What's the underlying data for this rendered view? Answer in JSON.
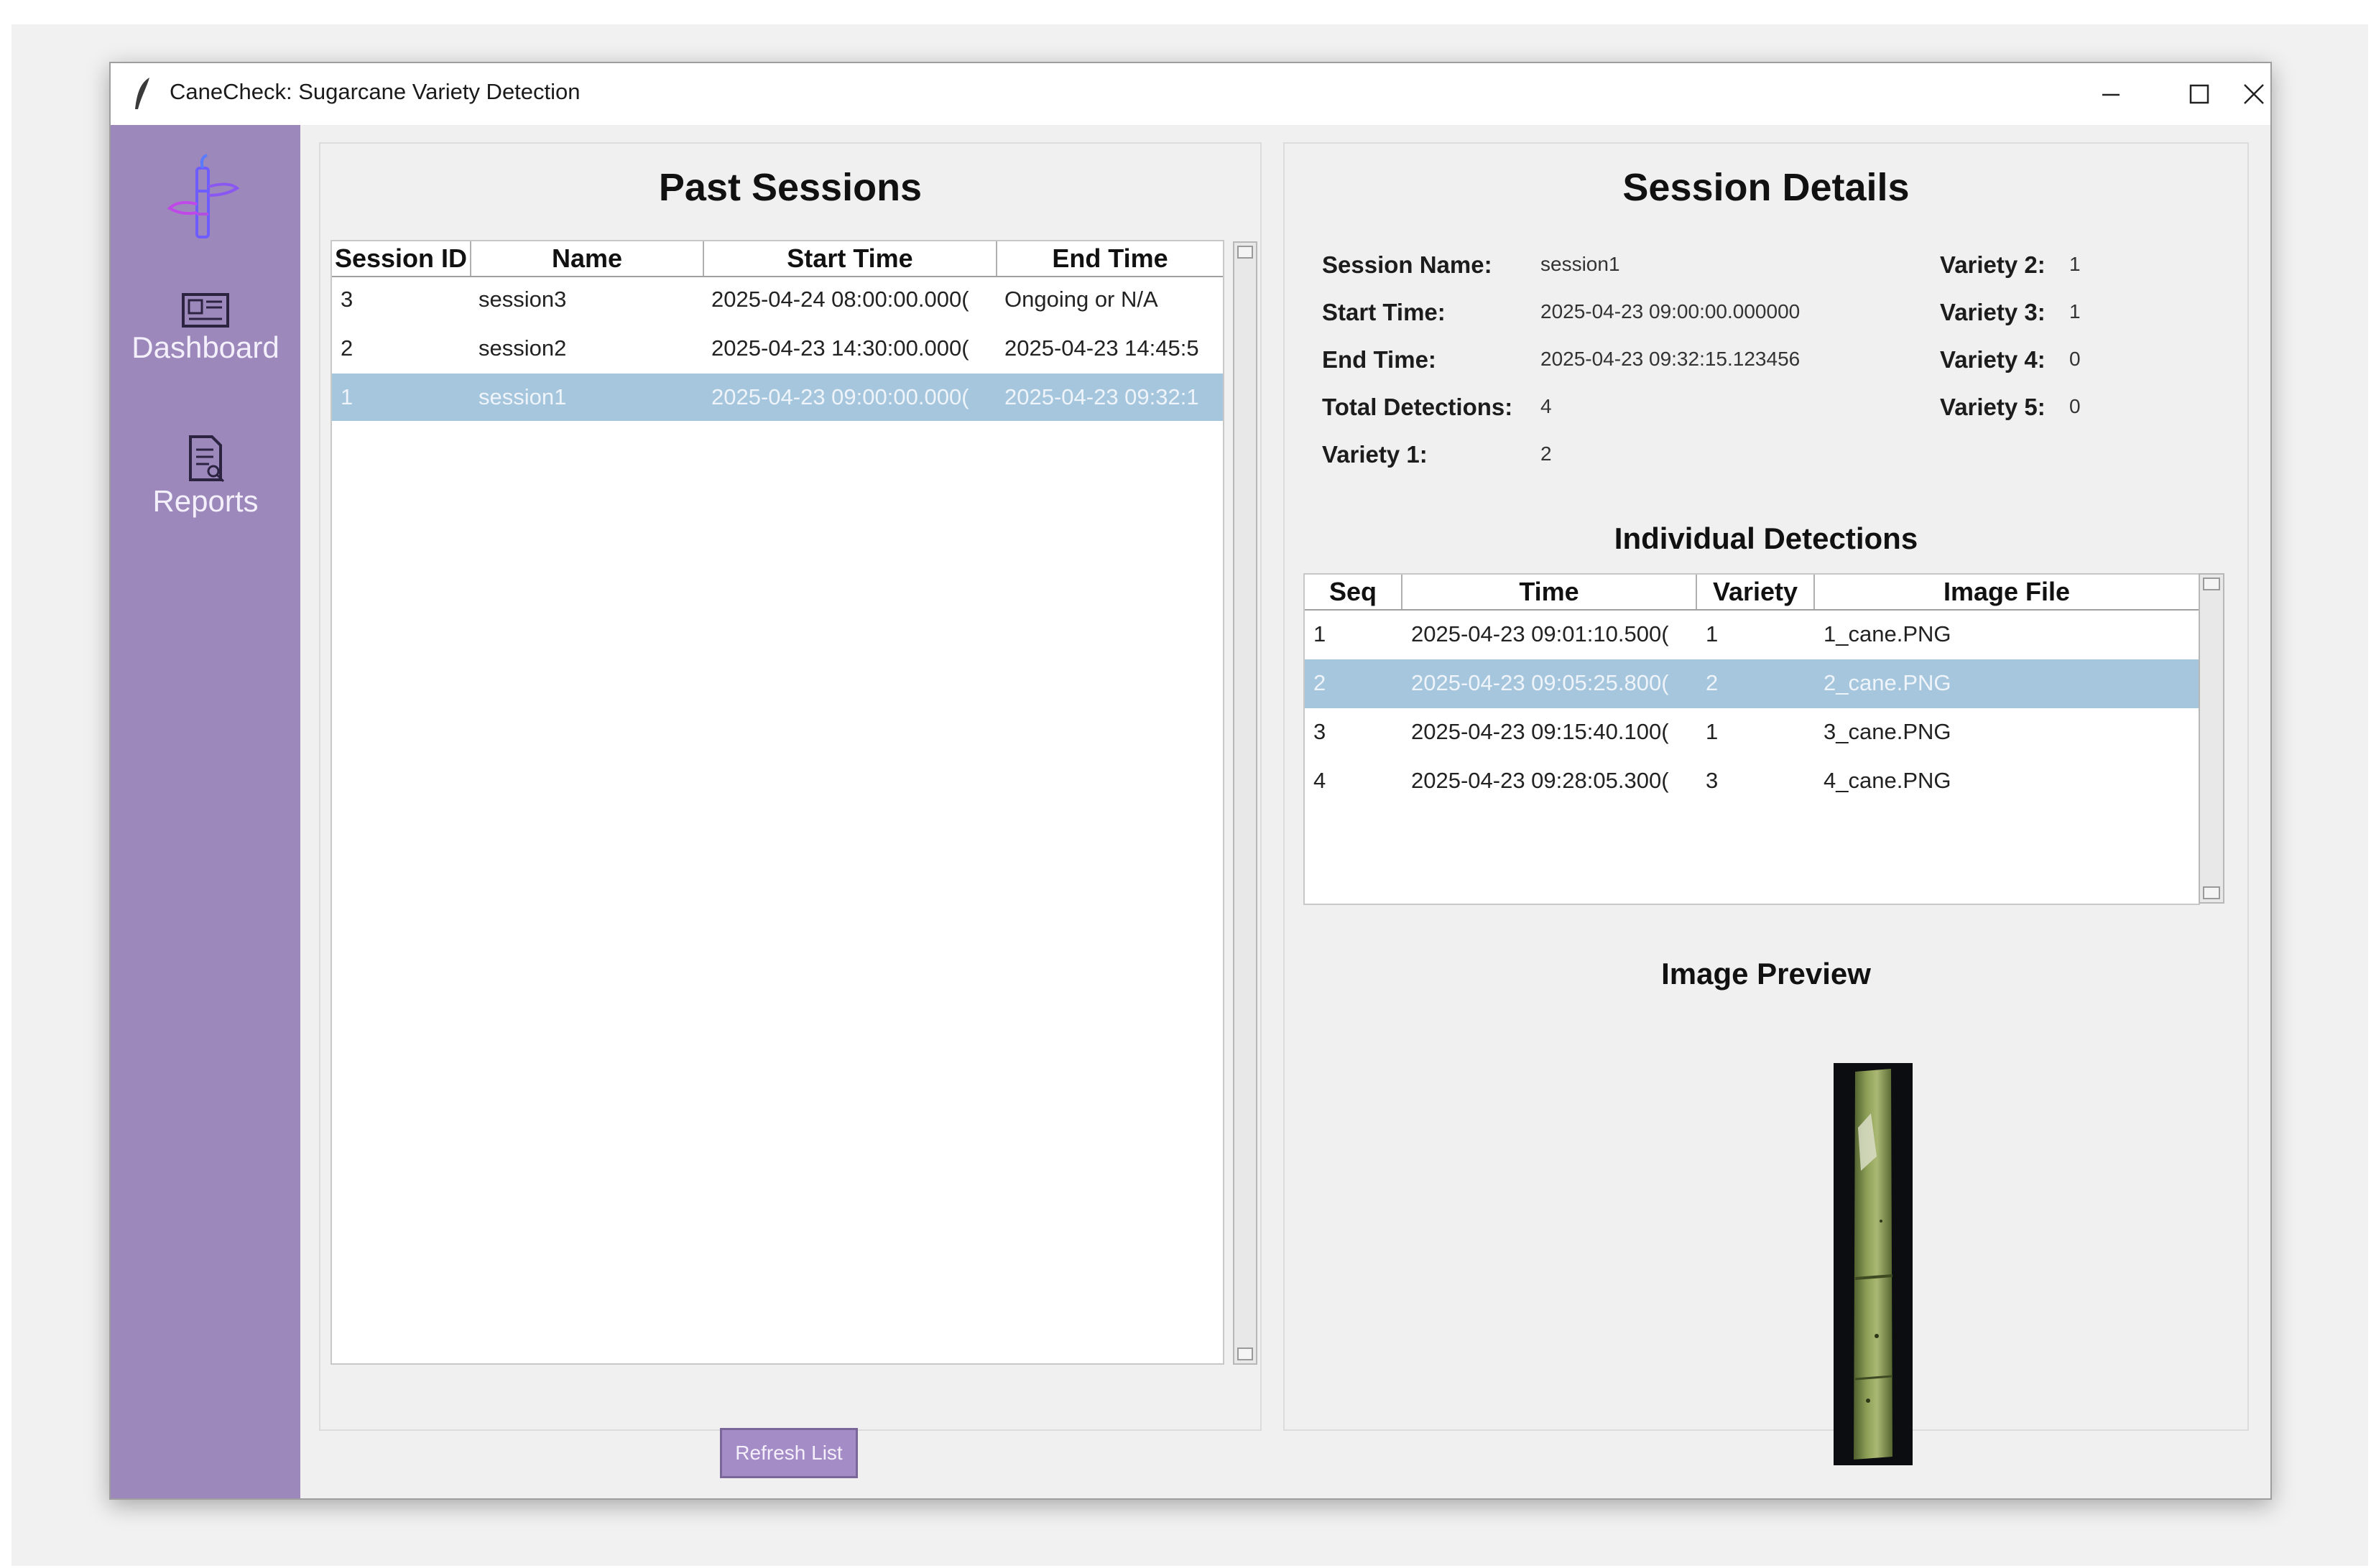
{
  "window": {
    "title": "CaneCheck: Sugarcane Variety Detection"
  },
  "sidebar": {
    "items": [
      {
        "label": "Dashboard",
        "icon": "dashboard-icon"
      },
      {
        "label": "Reports",
        "icon": "report-icon"
      }
    ]
  },
  "past_sessions": {
    "title": "Past Sessions",
    "columns": [
      "Session ID",
      "Name",
      "Start Time",
      "End Time"
    ],
    "rows": [
      {
        "id": "3",
        "name": "session3",
        "start": "2025-04-24 08:00:00.000(",
        "end": "Ongoing or N/A"
      },
      {
        "id": "2",
        "name": "session2",
        "start": "2025-04-23 14:30:00.000(",
        "end": "2025-04-23 14:45:5"
      },
      {
        "id": "1",
        "name": "session1",
        "start": "2025-04-23 09:00:00.000(",
        "end": "2025-04-23 09:32:1"
      }
    ],
    "selected_row": 2,
    "refresh_label": "Refresh List"
  },
  "session_details": {
    "title": "Session Details",
    "session_name_label": "Session Name:",
    "session_name": "session1",
    "start_label": "Start Time:",
    "start": "2025-04-23 09:00:00.000000",
    "end_label": "End Time:",
    "end": "2025-04-23 09:32:15.123456",
    "total_label": "Total Detections:",
    "total": "4",
    "variety1_label": "Variety 1:",
    "variety1": "2",
    "variety2_label": "Variety 2:",
    "variety2": "1",
    "variety3_label": "Variety 3:",
    "variety3": "1",
    "variety4_label": "Variety 4:",
    "variety4": "0",
    "variety5_label": "Variety 5:",
    "variety5": "0"
  },
  "detections": {
    "title": "Individual Detections",
    "columns": [
      "Seq",
      "Time",
      "Variety",
      "Image File"
    ],
    "rows": [
      {
        "seq": "1",
        "time": "2025-04-23 09:01:10.500(",
        "variety": "1",
        "file": "1_cane.PNG"
      },
      {
        "seq": "2",
        "time": "2025-04-23 09:05:25.800(",
        "variety": "2",
        "file": "2_cane.PNG"
      },
      {
        "seq": "3",
        "time": "2025-04-23 09:15:40.100(",
        "variety": "1",
        "file": "3_cane.PNG"
      },
      {
        "seq": "4",
        "time": "2025-04-23 09:28:05.300(",
        "variety": "3",
        "file": "4_cane.PNG"
      }
    ],
    "selected_row": 1
  },
  "preview": {
    "title": "Image Preview"
  },
  "colors": {
    "sidebar": "#9c88bb",
    "selection": "#a6c6dd",
    "button": "#a48cc6"
  }
}
